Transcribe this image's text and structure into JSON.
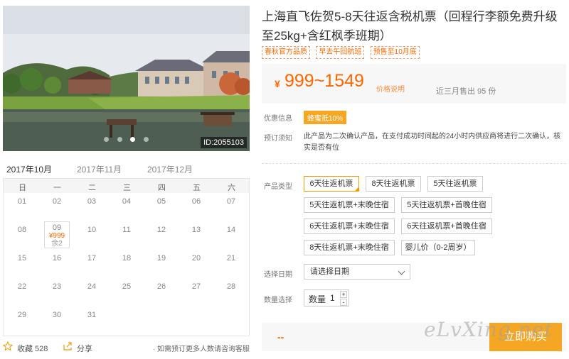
{
  "photo": {
    "id_label": "ID:2055103",
    "dots": 4,
    "active_dot": 2
  },
  "calendar": {
    "months": [
      "2017年10月",
      "2017年11月",
      "2017年12月"
    ],
    "active_month": 0,
    "weekdays": [
      "日",
      "一",
      "二",
      "三",
      "四",
      "五",
      "六"
    ],
    "weeks": [
      [
        "01",
        "02",
        "03",
        "04",
        "05",
        "06",
        "07"
      ],
      [
        "08",
        "09",
        "10",
        "11",
        "12",
        "13",
        "14"
      ],
      [
        "15",
        "16",
        "17",
        "18",
        "19",
        "20",
        "21"
      ],
      [
        "22",
        "23",
        "24",
        "25",
        "26",
        "27",
        "28"
      ],
      [
        "29",
        "30",
        "31",
        "",
        "",
        "",
        ""
      ]
    ],
    "selected_day": {
      "day": "09",
      "price": "¥999",
      "remaining": "余2"
    }
  },
  "bottom": {
    "favorite_label": "收藏 528",
    "share_label": "分享",
    "note": "· 如需预订更多人数请咨询客服"
  },
  "product": {
    "title": "上海直飞佐贺5-8天往返含税机票（回程行李额免费升级至25kg+含红枫季班期）",
    "tags": [
      "春秋官方品质",
      "早去午回航班",
      "预售至10月底"
    ]
  },
  "price": {
    "currency": "¥",
    "range": "999~1549",
    "explain_label": "价格说明",
    "sold_label": "近三月售出 95 份"
  },
  "info": {
    "promo_label": "优惠信息",
    "promo_badge": "蜂蜜抵10%",
    "notice_label": "预订须知",
    "notice_text": "此产品为二次确认产品，在支付成功时间起的24小时内供应商将进行二次确认，核实是否有位"
  },
  "options": {
    "label": "产品类型",
    "items": [
      "6天往返机票",
      "8天往返机票",
      "5天往返机票",
      "5天往返机票+末晚住宿",
      "5天往返机票+首晚住宿",
      "6天往返机票+末晚住宿",
      "6天往返机票+首晚住宿",
      "8天往返机票+末晚住宿",
      "婴儿价（0-2周岁）"
    ],
    "active_index": 0
  },
  "date": {
    "label": "选择日期",
    "placeholder": "请选择日期"
  },
  "quantity": {
    "label": "数量选择",
    "field_label": "数量",
    "value": "1",
    "plus": "+",
    "minus": "-"
  },
  "buy": {
    "total_placeholder": "--",
    "button_label": "立即购买"
  },
  "watermark": "eLvXing.net",
  "colors": {
    "accent": "#f39800",
    "price": "#ff6600",
    "button": "#f5a623"
  }
}
